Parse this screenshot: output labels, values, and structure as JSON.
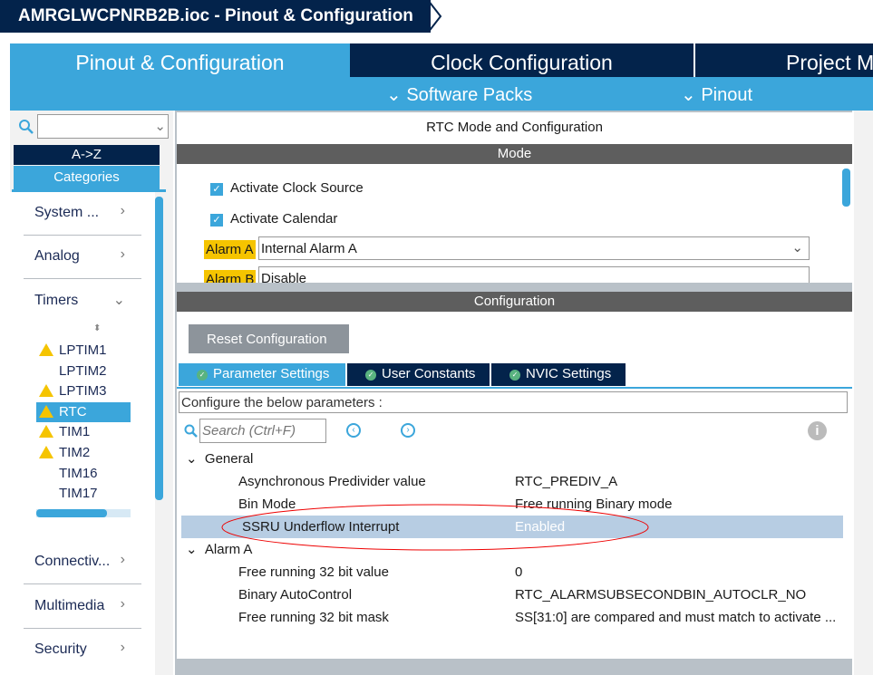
{
  "window": {
    "title": "AMRGLWCPNRB2B.ioc - Pinout & Configuration"
  },
  "tabs": [
    {
      "label": "Pinout & Configuration"
    },
    {
      "label": "Clock Configuration"
    },
    {
      "label": "Project M"
    }
  ],
  "subnav": {
    "software_packs": "Software Packs",
    "pinout": "Pinout"
  },
  "sidebar": {
    "sort_az": "A->Z",
    "categories": "Categories",
    "categories_list": [
      {
        "label": "System ..."
      },
      {
        "label": "Analog"
      },
      {
        "label": "Timers"
      },
      {
        "label": "Connectiv..."
      },
      {
        "label": "Multimedia"
      },
      {
        "label": "Security"
      }
    ],
    "timers": [
      {
        "label": "LPTIM1",
        "warn": true
      },
      {
        "label": "LPTIM2",
        "warn": false
      },
      {
        "label": "LPTIM3",
        "warn": true
      },
      {
        "label": "RTC",
        "warn": true,
        "selected": true
      },
      {
        "label": "TIM1",
        "warn": true
      },
      {
        "label": "TIM2",
        "warn": true
      },
      {
        "label": "TIM16",
        "warn": false
      },
      {
        "label": "TIM17",
        "warn": false
      }
    ]
  },
  "panel": {
    "title": "RTC Mode and Configuration",
    "mode_header": "Mode",
    "config_header": "Configuration",
    "activate_clock": "Activate Clock Source",
    "activate_calendar": "Activate Calendar",
    "alarm_a_label": "Alarm A",
    "alarm_a_value": "Internal Alarm A",
    "alarm_b_label": "Alarm B",
    "alarm_b_value": "Disable",
    "reset": "Reset Configuration",
    "ptabs": [
      "Parameter Settings",
      "User Constants",
      "NVIC Settings"
    ],
    "configure_text": "Configure the below parameters :",
    "search_placeholder": "Search (Ctrl+F)",
    "general": "General",
    "alarm_a_group": "Alarm A",
    "params": [
      {
        "k": "Asynchronous Predivider value",
        "v": "RTC_PREDIV_A"
      },
      {
        "k": "Bin Mode",
        "v": "Free running Binary mode"
      },
      {
        "k": "SSRU Underflow Interrupt",
        "v": "Enabled"
      },
      {
        "k": "Free running 32 bit value",
        "v": "0"
      },
      {
        "k": "Binary AutoControl",
        "v": "RTC_ALARMSUBSECONDBIN_AUTOCLR_NO"
      },
      {
        "k": "Free running 32 bit mask",
        "v": "SS[31:0] are compared and must match to activate ..."
      }
    ]
  }
}
